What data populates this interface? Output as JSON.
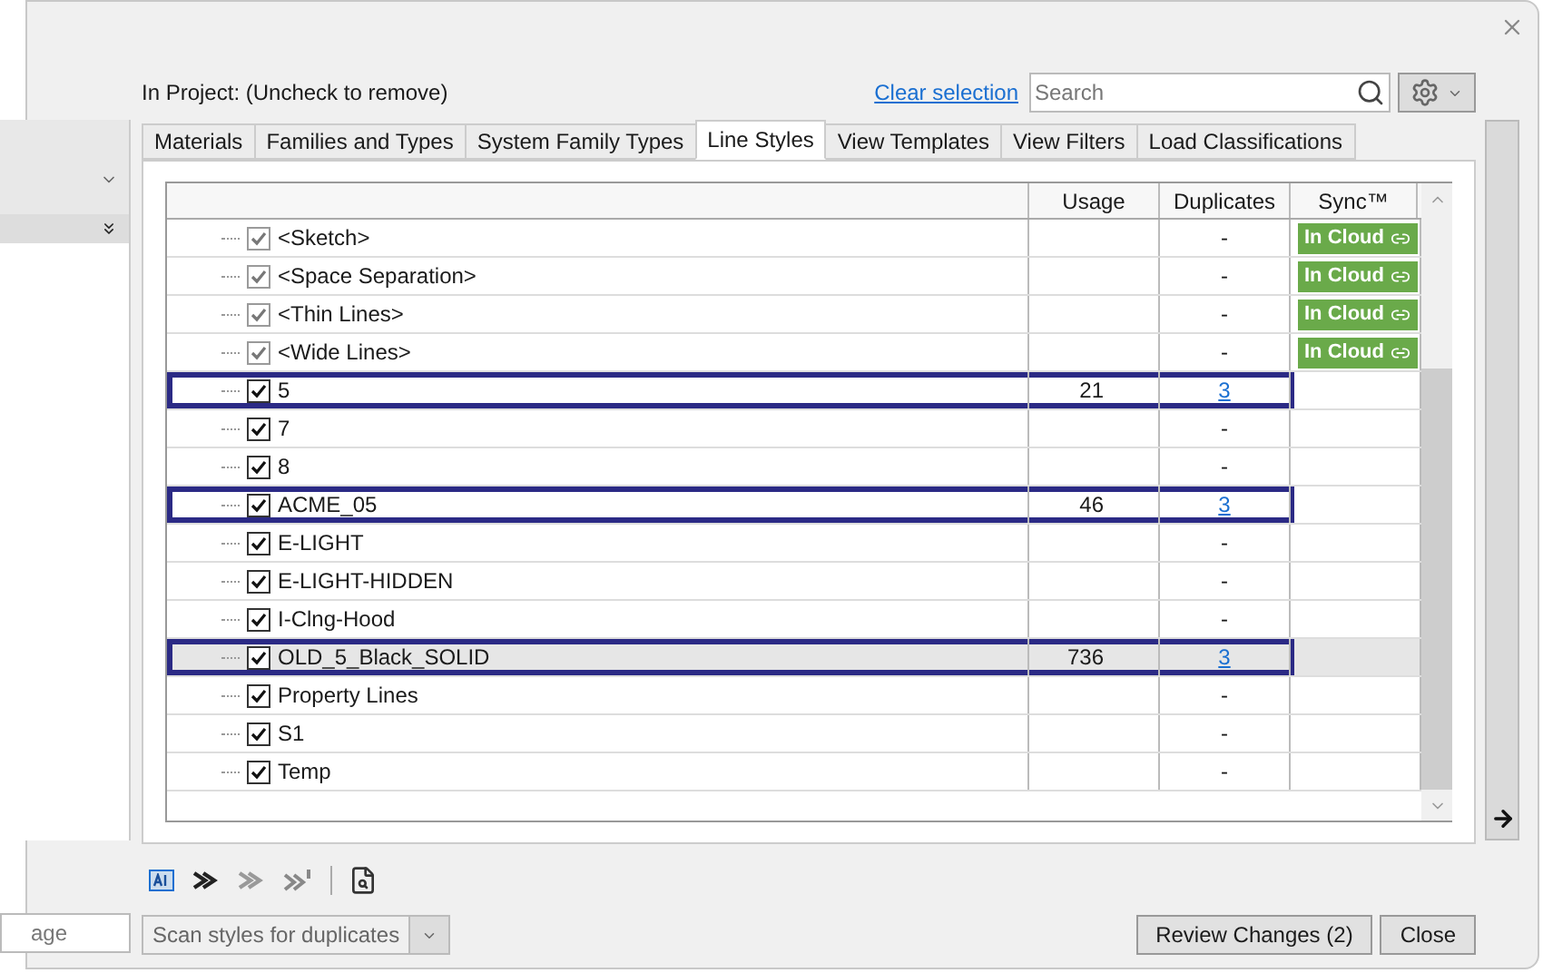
{
  "header": {
    "label": "In Project: (Uncheck to remove)",
    "clear_link": "Clear selection",
    "search": {
      "placeholder": "Search"
    }
  },
  "tabs": [
    {
      "label": "Materials",
      "selected": false
    },
    {
      "label": "Families and Types",
      "selected": false
    },
    {
      "label": "System Family Types",
      "selected": false
    },
    {
      "label": "Line Styles",
      "selected": true
    },
    {
      "label": "View Templates",
      "selected": false
    },
    {
      "label": "View Filters",
      "selected": false
    },
    {
      "label": "Load Classifications",
      "selected": false
    }
  ],
  "table": {
    "columns": [
      "Usage",
      "Duplicates",
      "Sync™"
    ],
    "rows": [
      {
        "name": "<Sketch>",
        "checked": true,
        "disabled": true,
        "usage": "",
        "duplicates": "-",
        "dup_link": false,
        "sync": "In Cloud",
        "highlighted": false,
        "selected": false
      },
      {
        "name": "<Space Separation>",
        "checked": true,
        "disabled": true,
        "usage": "",
        "duplicates": "-",
        "dup_link": false,
        "sync": "In Cloud",
        "highlighted": false,
        "selected": false
      },
      {
        "name": "<Thin Lines>",
        "checked": true,
        "disabled": true,
        "usage": "",
        "duplicates": "-",
        "dup_link": false,
        "sync": "In Cloud",
        "highlighted": false,
        "selected": false
      },
      {
        "name": "<Wide Lines>",
        "checked": true,
        "disabled": true,
        "usage": "",
        "duplicates": "-",
        "dup_link": false,
        "sync": "In Cloud",
        "highlighted": false,
        "selected": false
      },
      {
        "name": "5",
        "checked": true,
        "disabled": false,
        "usage": "21",
        "duplicates": "3",
        "dup_link": true,
        "highlighted": true,
        "selected": false
      },
      {
        "name": "7",
        "checked": true,
        "disabled": false,
        "usage": "",
        "duplicates": "-",
        "dup_link": false,
        "highlighted": false,
        "selected": false
      },
      {
        "name": "8",
        "checked": true,
        "disabled": false,
        "usage": "",
        "duplicates": "-",
        "dup_link": false,
        "highlighted": false,
        "selected": false
      },
      {
        "name": "ACME_05",
        "checked": true,
        "disabled": false,
        "usage": "46",
        "duplicates": "3",
        "dup_link": true,
        "highlighted": true,
        "selected": false
      },
      {
        "name": "E-LIGHT",
        "checked": true,
        "disabled": false,
        "usage": "",
        "duplicates": "-",
        "dup_link": false,
        "highlighted": false,
        "selected": false
      },
      {
        "name": "E-LIGHT-HIDDEN",
        "checked": true,
        "disabled": false,
        "usage": "",
        "duplicates": "-",
        "dup_link": false,
        "highlighted": false,
        "selected": false
      },
      {
        "name": "I-Clng-Hood",
        "checked": true,
        "disabled": false,
        "usage": "",
        "duplicates": "-",
        "dup_link": false,
        "highlighted": false,
        "selected": false
      },
      {
        "name": "OLD_5_Black_SOLID",
        "checked": true,
        "disabled": false,
        "usage": "736",
        "duplicates": "3",
        "dup_link": true,
        "highlighted": true,
        "selected": true
      },
      {
        "name": "Property Lines",
        "checked": true,
        "disabled": false,
        "usage": "",
        "duplicates": "-",
        "dup_link": false,
        "highlighted": false,
        "selected": false
      },
      {
        "name": "S1",
        "checked": true,
        "disabled": false,
        "usage": "",
        "duplicates": "-",
        "dup_link": false,
        "highlighted": false,
        "selected": false
      },
      {
        "name": "Temp",
        "checked": true,
        "disabled": false,
        "usage": "",
        "duplicates": "-",
        "dup_link": false,
        "highlighted": false,
        "selected": false
      }
    ]
  },
  "left_panel": {
    "field_value": "age"
  },
  "footer": {
    "scan_dropdown": "Scan styles for duplicates",
    "buttons": [
      "Review Changes (2)",
      "Close"
    ]
  }
}
